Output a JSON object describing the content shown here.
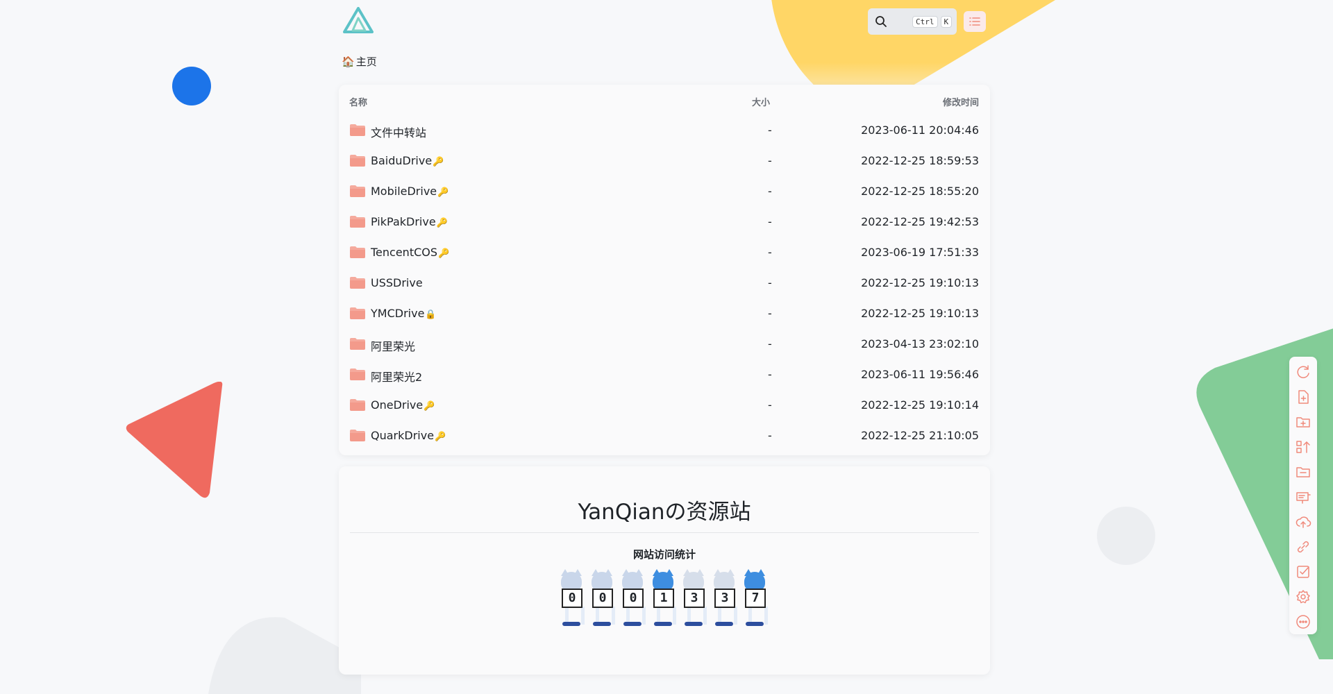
{
  "app": {
    "brand_color": "#5cc2c7",
    "accent_color": "#f0897b"
  },
  "header": {
    "logo": "alist-logo-icon",
    "search": {
      "key1": "Ctrl",
      "key2": "K"
    }
  },
  "breadcrumb": {
    "icon": "🏠",
    "label": "主页"
  },
  "table": {
    "columns": {
      "name": "名称",
      "size": "大小",
      "modified": "修改时间"
    },
    "rows": [
      {
        "name": "文件中转站",
        "badge": "",
        "size": "-",
        "modified": "2023-06-11 20:04:46"
      },
      {
        "name": "BaiduDrive",
        "badge": "🔑",
        "size": "-",
        "modified": "2022-12-25 18:59:53"
      },
      {
        "name": "MobileDrive",
        "badge": "🔑",
        "size": "-",
        "modified": "2022-12-25 18:55:20"
      },
      {
        "name": "PikPakDrive",
        "badge": "🔑",
        "size": "-",
        "modified": "2022-12-25 19:42:53"
      },
      {
        "name": "TencentCOS",
        "badge": "🔑",
        "size": "-",
        "modified": "2023-06-19 17:51:33"
      },
      {
        "name": "USSDrive",
        "badge": "",
        "size": "-",
        "modified": "2022-12-25 19:10:13"
      },
      {
        "name": "YMCDrive",
        "badge": "🔒",
        "size": "-",
        "modified": "2022-12-25 19:10:13"
      },
      {
        "name": "阿里荣光",
        "badge": "",
        "size": "-",
        "modified": "2023-04-13 23:02:10"
      },
      {
        "name": "阿里荣光2",
        "badge": "",
        "size": "-",
        "modified": "2023-06-11 19:56:46"
      },
      {
        "name": "OneDrive",
        "badge": "🔑",
        "size": "-",
        "modified": "2022-12-25 19:10:14"
      },
      {
        "name": "QuarkDrive",
        "badge": "🔑",
        "size": "-",
        "modified": "2022-12-25 21:10:05"
      }
    ]
  },
  "readme": {
    "title": "YanQianの资源站",
    "stats_title": "网站访问统计",
    "counter_digits": [
      "0",
      "0",
      "0",
      "1",
      "3",
      "3",
      "7"
    ]
  },
  "toolbar": {
    "tools": [
      "refresh-icon",
      "new-file-icon",
      "new-folder-icon",
      "sort-icon",
      "folder-icon",
      "remote-icon",
      "upload-icon",
      "link-icon",
      "check-icon",
      "settings-icon",
      "more-icon"
    ]
  }
}
